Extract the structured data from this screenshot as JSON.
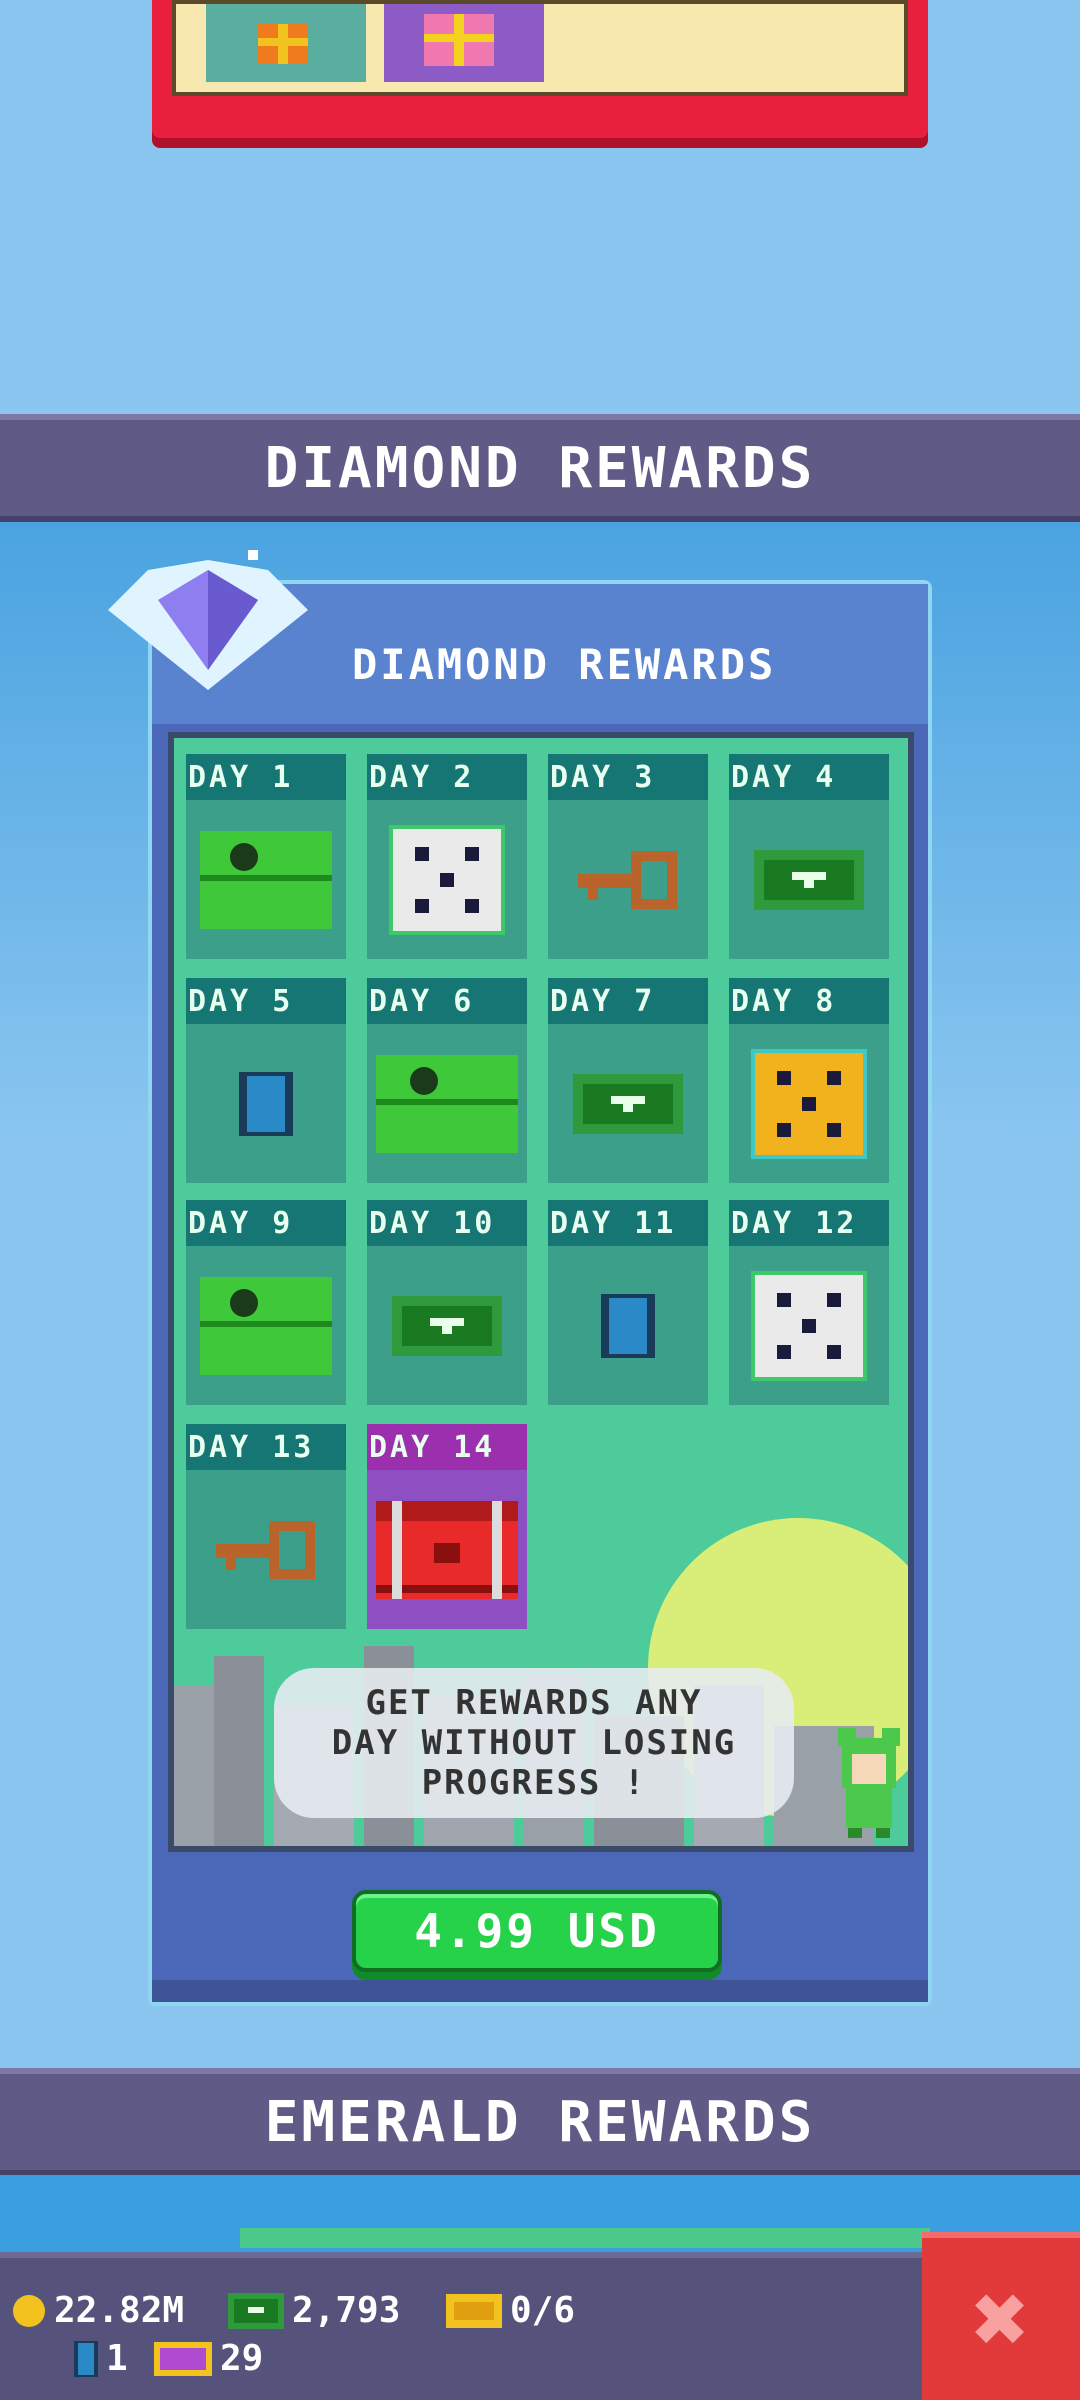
{
  "sections": {
    "diamond_header": "DIAMOND REWARDS",
    "emerald_header": "EMERALD REWARDS"
  },
  "card": {
    "title": "DIAMOND REWARDS",
    "days": [
      {
        "label": "DAY 1",
        "reward": "green-chest-icon"
      },
      {
        "label": "DAY 2",
        "reward": "white-dice-icon"
      },
      {
        "label": "DAY 3",
        "reward": "key-icon"
      },
      {
        "label": "DAY 4",
        "reward": "cash-icon"
      },
      {
        "label": "DAY 5",
        "reward": "blue-gem-icon"
      },
      {
        "label": "DAY 6",
        "reward": "green-chest-icon"
      },
      {
        "label": "DAY 7",
        "reward": "cash-icon"
      },
      {
        "label": "DAY 8",
        "reward": "gold-dice-icon"
      },
      {
        "label": "DAY 9",
        "reward": "green-chest-icon"
      },
      {
        "label": "DAY 10",
        "reward": "cash-icon"
      },
      {
        "label": "DAY 11",
        "reward": "blue-gem-icon"
      },
      {
        "label": "DAY 12",
        "reward": "white-dice-icon"
      },
      {
        "label": "DAY 13",
        "reward": "key-icon"
      },
      {
        "label": "DAY 14",
        "reward": "red-chest-icon"
      }
    ],
    "message": "GET REWARDS ANY\nDAY WITHOUT LOSING\nPROGRESS !",
    "buy_label": "4.99 USD"
  },
  "status": {
    "coins": "22.82M",
    "cash": "2,793",
    "tickets": "0/6",
    "gems": "1",
    "vip": "29"
  },
  "colors": {
    "accent_green": "#26d24a",
    "bar": "#5f5b86",
    "close": "#e23a3a"
  }
}
